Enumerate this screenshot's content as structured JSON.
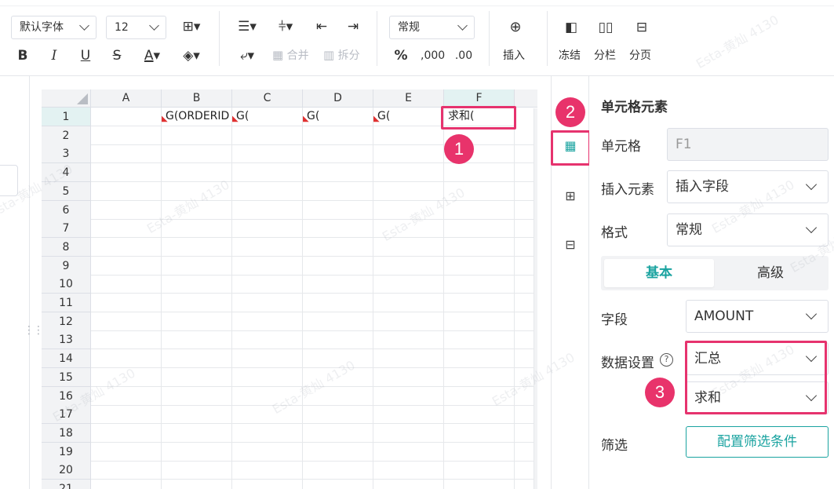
{
  "toolbar": {
    "font_family": "默认字体",
    "font_size": "12",
    "number_format": "常规",
    "bold": "B",
    "italic": "I",
    "underline": "U",
    "strike": "S",
    "font_color": "A",
    "merge_label": "合并",
    "split_label": "拆分",
    "percent": "%",
    "thousands": ",000",
    "decimal": ".00",
    "insert_label": "插入",
    "freeze_label": "冻结",
    "columns_label": "分栏",
    "paging_label": "分页"
  },
  "sheet": {
    "columns": [
      "A",
      "B",
      "C",
      "D",
      "E",
      "F"
    ],
    "rows": [
      "1",
      "2",
      "3",
      "4",
      "5",
      "6",
      "7",
      "8",
      "9",
      "10",
      "11",
      "12",
      "13",
      "14",
      "15",
      "16",
      "17",
      "18",
      "19",
      "20",
      "21"
    ],
    "row1": {
      "A": "",
      "B": "G(ORDERID",
      "C": "G(",
      "D": "G(",
      "E": "G(",
      "F": "求和("
    }
  },
  "badges": [
    "1",
    "2",
    "3"
  ],
  "panel": {
    "title": "单元格元素",
    "cell_label": "单元格",
    "cell_value": "F1",
    "insert_label": "插入元素",
    "insert_value": "插入字段",
    "format_label": "格式",
    "format_value": "常规",
    "tabs": [
      "基本",
      "高级"
    ],
    "field_label": "字段",
    "field_value": "AMOUNT",
    "data_setting_label": "数据设置",
    "data_setting_value": "汇总",
    "aggregate_value": "求和",
    "filter_label": "筛选",
    "filter_button": "配置筛选条件"
  },
  "watermark": "Esta-黄灿 4130",
  "colors": {
    "accent": "#1aa3a0",
    "highlight": "#e6336e"
  }
}
